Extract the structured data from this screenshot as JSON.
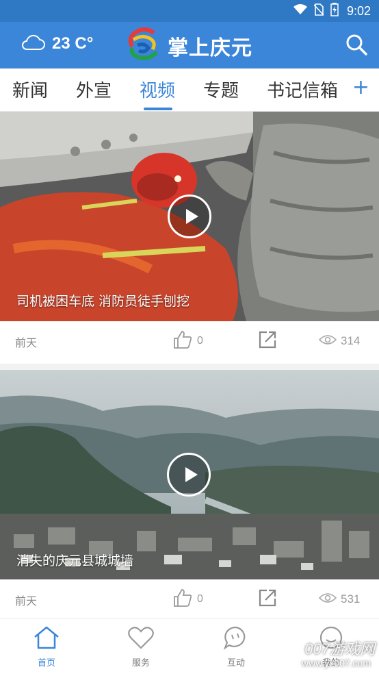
{
  "status": {
    "time": "9:02"
  },
  "header": {
    "temperature": "23 C°",
    "brand": "掌上庆元"
  },
  "tabs": [
    {
      "label": "新闻"
    },
    {
      "label": "外宣"
    },
    {
      "label": "视频",
      "active": true
    },
    {
      "label": "专题"
    },
    {
      "label": "书记信箱"
    }
  ],
  "tab_add": "+",
  "videos": [
    {
      "caption": "司机被困车底 消防员徒手刨挖",
      "date": "前天",
      "likes": "0",
      "views": "314"
    },
    {
      "caption": "消失的庆元县城城墙",
      "date": "前天",
      "likes": "0",
      "views": "531"
    }
  ],
  "bottom_nav": [
    {
      "label": "首页",
      "icon": "home-icon",
      "active": true
    },
    {
      "label": "服务",
      "icon": "heart-icon"
    },
    {
      "label": "互动",
      "icon": "chat-icon"
    },
    {
      "label": "我的",
      "icon": "smile-icon"
    }
  ],
  "watermark": {
    "line1": "007游戏网",
    "line2": "www.yx007.com"
  },
  "colors": {
    "primary": "#3b86d8",
    "status_bar": "#2f78c4"
  }
}
